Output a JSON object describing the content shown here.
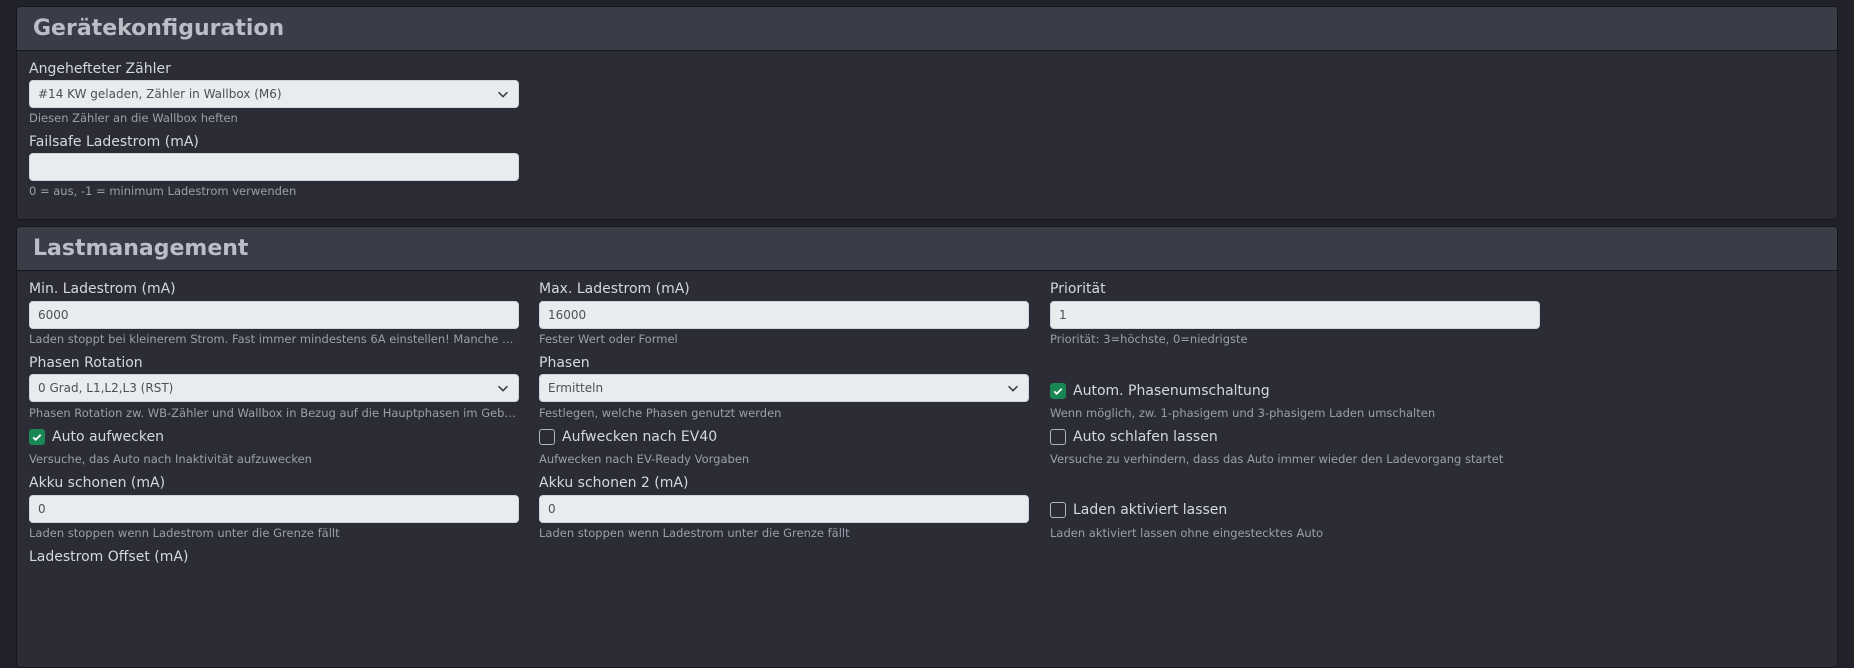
{
  "device_config": {
    "title": "Gerätekonfiguration",
    "meter_label": "Angehefteter Zähler",
    "meter_value": "#14 KW geladen, Zähler in Wallbox (M6)",
    "meter_help": "Diesen Zähler an die Wallbox heften",
    "failsafe_label": "Failsafe Ladestrom (mA)",
    "failsafe_value": "",
    "failsafe_help": "0 = aus, -1 = minimum Ladestrom verwenden"
  },
  "load_management": {
    "title": "Lastmanagement",
    "min_current": {
      "label": "Min. Ladestrom (mA)",
      "value": "6000",
      "help": "Laden stoppt bei kleinerem Strom. Fast immer mindestens 6A einstellen! Manche Autos benötigen..."
    },
    "max_current": {
      "label": "Max. Ladestrom (mA)",
      "value": "16000",
      "help": "Fester Wert oder Formel"
    },
    "priority": {
      "label": "Priorität",
      "value": "1",
      "help": "Priorität: 3=höchste, 0=niedrigste"
    },
    "phase_rotation": {
      "label": "Phasen Rotation",
      "value": "0 Grad, L1,L2,L3 (RST)",
      "help": "Phasen Rotation zw. WB-Zähler und Wallbox in Bezug auf die Hauptphasen im Gebäude"
    },
    "phases": {
      "label": "Phasen",
      "value": "Ermitteln",
      "help": "Festlegen, welche Phasen genutzt werden"
    },
    "auto_phase_switch": {
      "label": "Autom. Phasenumschaltung",
      "checked": true,
      "help": "Wenn möglich, zw. 1-phasigem und 3-phasigem Laden umschalten"
    },
    "wake_up": {
      "label": "Auto aufwecken",
      "checked": true,
      "help": "Versuche, das Auto nach Inaktivität aufzuwecken"
    },
    "wake_up_ev40": {
      "label": "Aufwecken nach EV40",
      "checked": false,
      "help": "Aufwecken nach EV-Ready Vorgaben"
    },
    "auto_sleep": {
      "label": "Auto schlafen lassen",
      "checked": false,
      "help": "Versuche zu verhindern, dass das Auto immer wieder den Ladevorgang startet"
    },
    "battery_save": {
      "label": "Akku schonen (mA)",
      "value": "0",
      "help": "Laden stoppen wenn Ladestrom unter die Grenze fällt"
    },
    "battery_save_2": {
      "label": "Akku schonen 2 (mA)",
      "value": "0",
      "help": "Laden stoppen wenn Ladestrom unter die Grenze fällt"
    },
    "keep_enabled": {
      "label": "Laden aktiviert lassen",
      "checked": false,
      "help": "Laden aktiviert lassen ohne eingestecktes Auto"
    },
    "offset_label": "Ladestrom Offset (mA)"
  },
  "colors": {
    "background": "#212229",
    "card": "#2b2c35",
    "card_header": "#3a3d48",
    "checkbox_checked": "#198754"
  }
}
